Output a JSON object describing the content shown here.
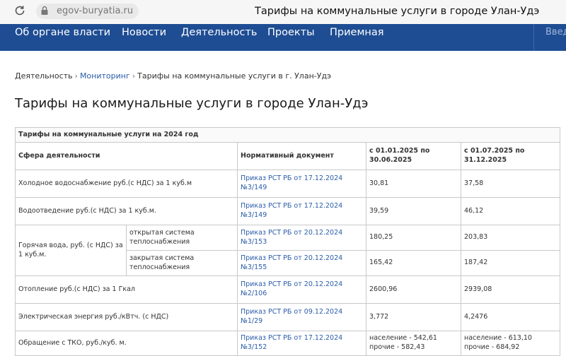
{
  "browser": {
    "url": "egov-buryatia.ru",
    "page_title": "Тарифы на коммунальные услуги в городе Улан-Удэ"
  },
  "nav": {
    "items": [
      "Об органе власти",
      "Новости",
      "Деятельность",
      "Проекты",
      "Приемная"
    ],
    "more": "Введ"
  },
  "breadcrumb": {
    "items": [
      "Деятельность",
      "Мониторинг"
    ],
    "current": "Тарифы на коммунальные услуги в г. Улан-Удэ"
  },
  "heading": "Тарифы на коммунальные услуги в городе Улан-Удэ",
  "table": {
    "caption": "Тарифы на коммунальные услуги на 2024 год",
    "headers": {
      "sphere": "Сфера деятельности",
      "doc": "Нормативный документ",
      "period1": "с 01.01.2025 по 30.06.2025",
      "period2": "с 01.07.2025 по 31.12.2025"
    },
    "rows": {
      "cold_water": {
        "name": "Холодное водоснабжение руб.(с НДС) за 1 куб.м",
        "doc": "Приказ РСТ РБ от 17.12.2024 №3/149",
        "v1": "30,81",
        "v2": "37,58"
      },
      "sewage": {
        "name": "Водоотведение руб.(с НДС) за 1 куб.м.",
        "doc": "Приказ РСТ РБ от 17.12.2024 №3/149",
        "v1": "39,59",
        "v2": "46,12"
      },
      "hot_water": {
        "name": "Горячая вода, руб. (с НДС) за 1 куб.м.",
        "open": {
          "label": "открытая система теплоснабжения",
          "doc": "Приказ РСТ РБ от 20.12.2024 №3/153",
          "v1": "180,25",
          "v2": "203,83"
        },
        "closed": {
          "label": "закрытая система теплоснабжения",
          "doc": "Приказ РСТ РБ от 20.12.2024 №3/155",
          "v1": "165,42",
          "v2": "187,42"
        }
      },
      "heating": {
        "name": "Отопление руб.(с НДС) за 1 Гкал",
        "doc": "Приказ РСТ РБ от 20.12.2024 №2/106",
        "v1": "2600,96",
        "v2": "2939,08"
      },
      "electricity": {
        "name": "Электрическая энергия руб./кВтч. (с НДС)",
        "doc": "Приказ РСТ РБ от 09.12.2024 №1/29",
        "v1": "3,772",
        "v2": "4,2476"
      },
      "tko": {
        "name": "Обращение с ТКО, руб./куб. м.",
        "doc": "Приказ РСТ РБ от 17.12.2024 №3/152",
        "v1_pop": "население - 542,61",
        "v1_other": "прочие - 582,43",
        "v2_pop": "население - 613,10",
        "v2_other": "прочие - 684,92"
      }
    }
  }
}
